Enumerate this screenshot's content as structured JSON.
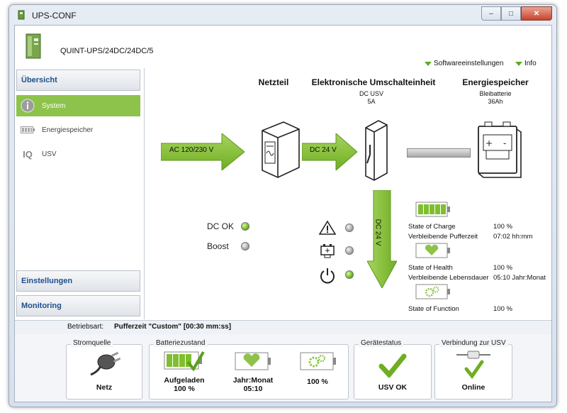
{
  "window": {
    "title": "UPS-CONF",
    "min": "–",
    "max": "□",
    "close": "✕"
  },
  "header": {
    "device_name": "QUINT-UPS/24DC/24DC/5",
    "links": [
      "Softwareeinstellungen",
      "Info"
    ]
  },
  "sidebar": {
    "overview": "Übersicht",
    "items": [
      {
        "label": "System",
        "icon": "info-icon",
        "active": true
      },
      {
        "label": "Energiespeicher",
        "icon": "battery-icon",
        "active": false
      },
      {
        "label": "USV",
        "icon": "iq-icon",
        "active": false
      }
    ],
    "settings": "Einstellungen",
    "monitoring": "Monitoring",
    "iq_text": "IQ"
  },
  "diagram": {
    "netzteil": "Netzteil",
    "umschalt": "Elektronische Umschalteinheit",
    "umschalt_sub1": "DC USV",
    "umschalt_sub2": "5A",
    "energie": "Energiespeicher",
    "energie_sub1": "Bleibatterie",
    "energie_sub2": "36Ah",
    "arrow_ac": "AC 120/230 V",
    "arrow_dc": "DC 24 V",
    "arrow_down": "DC 24 V",
    "dc_ok": "DC OK",
    "boost": "Boost",
    "dc_ok_led": "green",
    "boost_led": "grey",
    "led_warning": "grey",
    "led_battery": "grey",
    "led_power": "green"
  },
  "stats": {
    "soc_label": "State of Charge",
    "soc_value": "100 %",
    "buffer_label": "Verbleibende Pufferzeit",
    "buffer_value": "07:02 hh:mm",
    "soh_label": "State of Health",
    "soh_value": "100 %",
    "life_label": "Verbleibende Lebensdauer",
    "life_value": "05:10 Jahr:Monat",
    "sof_label": "State of Function",
    "sof_value": "100 %"
  },
  "status": {
    "mode_label": "Betriebsart:",
    "mode_value": "Pufferzeit \"Custom\" [00:30 mm:ss]"
  },
  "bottom": {
    "stromquelle": {
      "title": "Stromquelle",
      "value": "Netz"
    },
    "batterie": {
      "title": "Batteriezustand",
      "charge_line1": "Aufgeladen",
      "charge_line2": "100 %",
      "health_line1": "Jahr:Monat",
      "health_line2": "05:10",
      "function_value": "100 %"
    },
    "geraet": {
      "title": "Gerätestatus",
      "value": "USV OK"
    },
    "verbindung": {
      "title": "Verbindung zur USV",
      "value": "Online"
    }
  },
  "colors": {
    "accent": "#8dc34a",
    "arrow": "#7fbf2f",
    "link": "#1f4f8f"
  }
}
